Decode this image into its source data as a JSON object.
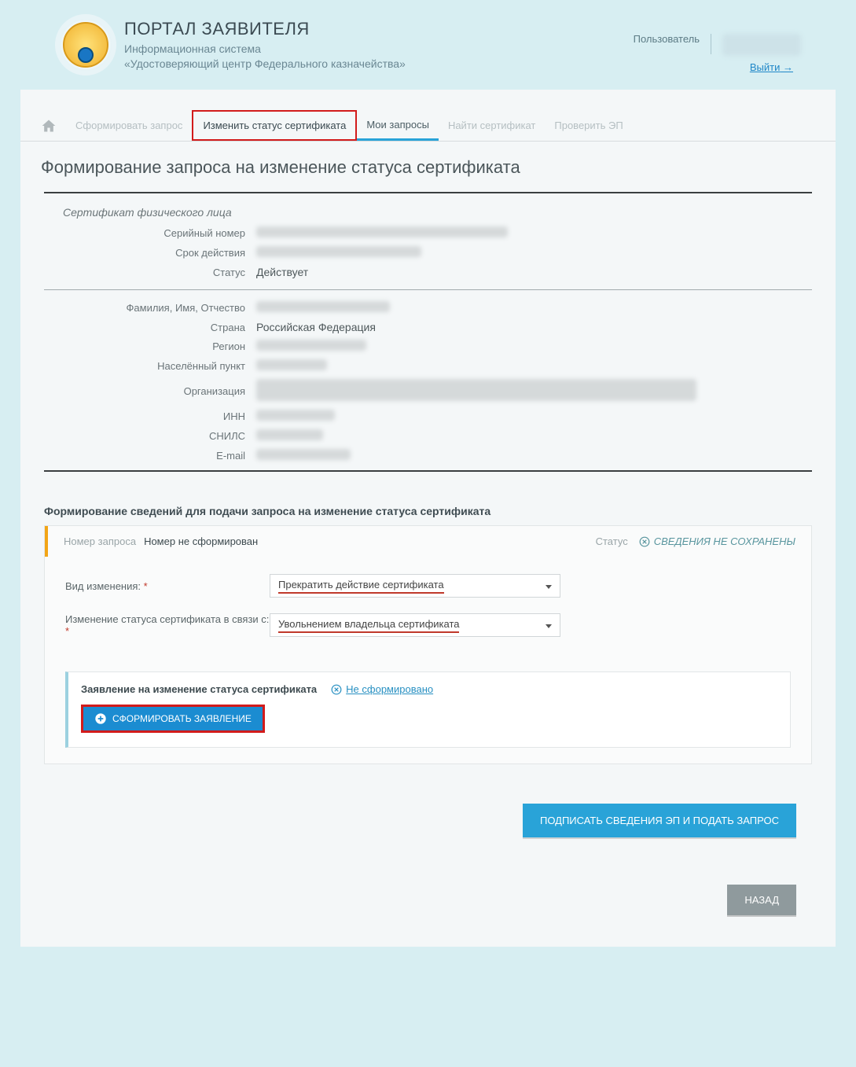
{
  "header": {
    "title": "ПОРТАЛ ЗАЯВИТЕЛЯ",
    "subtitle1": "Информационная система",
    "subtitle2": "«Удостоверяющий центр Федерального казначейства»",
    "userLabel": "Пользователь",
    "logout": "Выйти"
  },
  "tabs": {
    "t1": "Сформировать запрос",
    "t2": "Изменить статус сертификата",
    "t3": "Мои запросы",
    "t4": "Найти сертификат",
    "t5": "Проверить ЭП"
  },
  "page": {
    "title": "Формирование запроса на изменение статуса сертификата"
  },
  "cert": {
    "section": "Сертификат физического лица",
    "labels": {
      "serial": "Серийный номер",
      "validity": "Срок действия",
      "status": "Статус",
      "fio": "Фамилия, Имя, Отчество",
      "country": "Страна",
      "region": "Регион",
      "city": "Населённый пункт",
      "org": "Организация",
      "inn": "ИНН",
      "snils": "СНИЛС",
      "email": "E-mail"
    },
    "statusValue": "Действует",
    "countryValue": "Российская Федерация"
  },
  "form": {
    "heading": "Формирование сведений для подачи запроса на изменение статуса сертификата",
    "reqNumLabel": "Номер запроса",
    "reqNumValue": "Номер не сформирован",
    "statusLabel": "Статус",
    "statusValue": "СВЕДЕНИЯ НЕ СОХРАНЕНЫ",
    "changeTypeLabel": "Вид изменения:",
    "changeTypeValue": "Прекратить действие сертификата",
    "reasonLabel": "Изменение статуса сертификата в связи с:",
    "reasonValue": "Увольнением владельца сертификата",
    "appTitle": "Заявление на изменение статуса сертификата",
    "appStatus": " Не сформировано",
    "createBtn": "СФОРМИРОВАТЬ ЗАЯВЛЕНИЕ"
  },
  "actions": {
    "submit": "ПОДПИСАТЬ СВЕДЕНИЯ ЭП И ПОДАТЬ ЗАПРОС",
    "back": "НАЗАД"
  }
}
